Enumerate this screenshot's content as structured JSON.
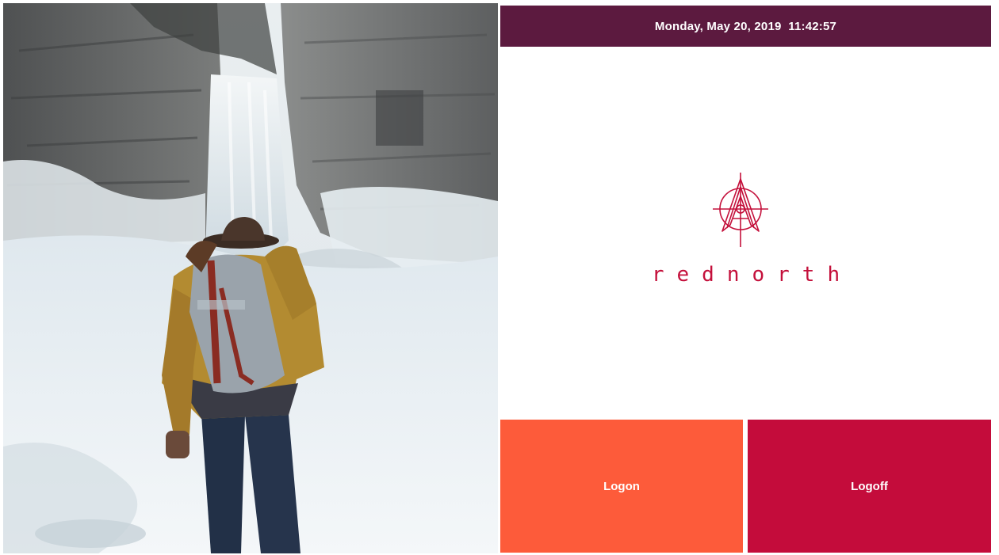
{
  "header": {
    "datetime": "Monday, May 20, 2019  11:42:57"
  },
  "brand": {
    "name": "rednorth",
    "logo_icon": "rednorth-logo-icon",
    "color": "#c4103b"
  },
  "actions": {
    "logon": {
      "label": "Logon",
      "color": "#fd5b3a"
    },
    "logoff": {
      "label": "Logoff",
      "color": "#c40c3b"
    }
  },
  "theme": {
    "header_bg": "#5c1a3f",
    "background": "#ffffff"
  }
}
